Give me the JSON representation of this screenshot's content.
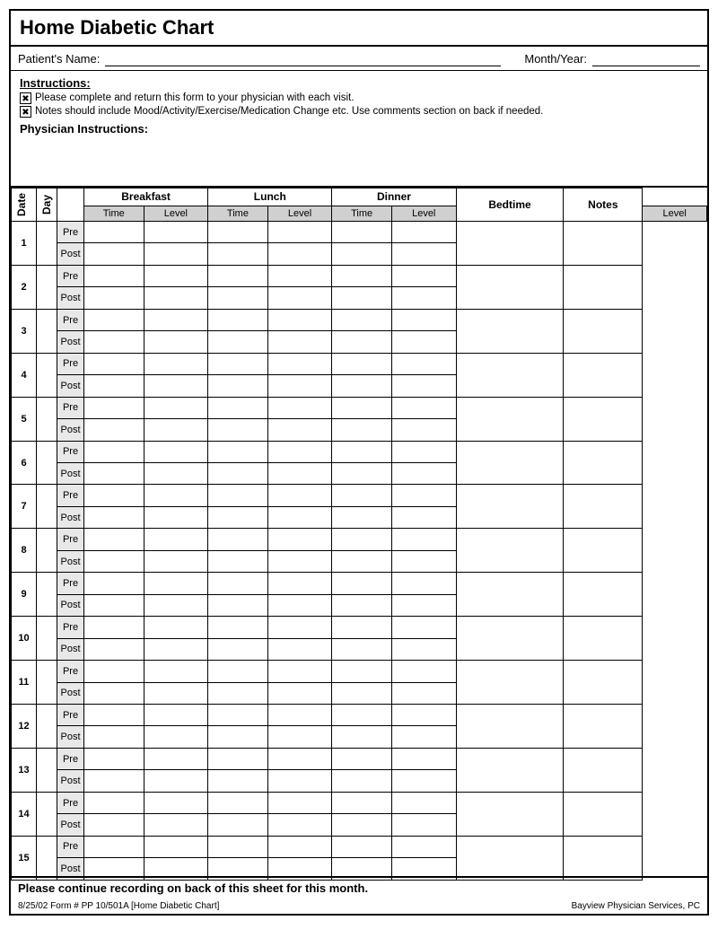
{
  "title": "Home Diabetic Chart",
  "patient_label": "Patient's Name:",
  "month_label": "Month/Year:",
  "instructions": {
    "title": "Instructions:",
    "line1": "Please complete and return this form to your physician with each visit.",
    "line2": "Notes should include Mood/Activity/Exercise/Medication Change etc.  Use comments section on back if needed.",
    "physician_label": "Physician Instructions:"
  },
  "table": {
    "headers": {
      "date": "Date",
      "day": "Day",
      "breakfast": "Breakfast",
      "lunch": "Lunch",
      "dinner": "Dinner",
      "bedtime": "Bedtime",
      "notes": "Notes"
    },
    "sub_headers": {
      "time": "Time",
      "level": "Level"
    },
    "bedtime_sub": "Level",
    "pre": "Pre",
    "post": "Post",
    "rows": [
      1,
      2,
      3,
      4,
      5,
      6,
      7,
      8,
      9,
      10,
      11,
      12,
      13,
      14,
      15
    ]
  },
  "footer": {
    "continue_text": "Please continue recording on back of this sheet for this month.",
    "form_info": "8/25/02  Form # PP 10/501A   [Home Diabetic Chart]",
    "company": "Bayview Physician Services, PC"
  }
}
